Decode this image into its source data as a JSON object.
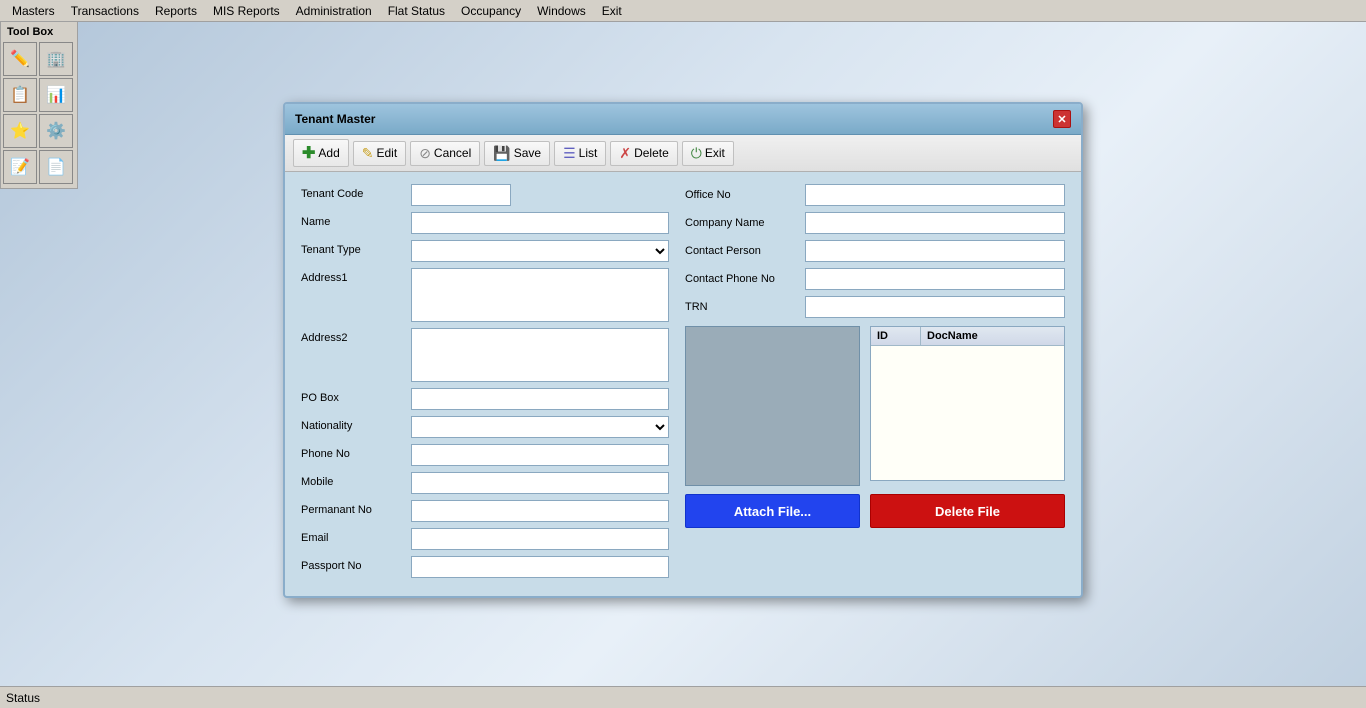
{
  "menubar": {
    "items": [
      {
        "label": "Masters",
        "id": "masters"
      },
      {
        "label": "Transactions",
        "id": "transactions"
      },
      {
        "label": "Reports",
        "id": "reports"
      },
      {
        "label": "MIS Reports",
        "id": "mis-reports"
      },
      {
        "label": "Administration",
        "id": "administration"
      },
      {
        "label": "Flat Status",
        "id": "flat-status"
      },
      {
        "label": "Occupancy",
        "id": "occupancy"
      },
      {
        "label": "Windows",
        "id": "windows"
      },
      {
        "label": "Exit",
        "id": "exit"
      }
    ]
  },
  "toolbox": {
    "title": "Tool Box"
  },
  "statusbar": {
    "label": "Status"
  },
  "modal": {
    "title": "Tenant Master",
    "toolbar": {
      "add": "Add",
      "edit": "Edit",
      "cancel": "Cancel",
      "save": "Save",
      "list": "List",
      "delete": "Delete",
      "exit": "Exit"
    },
    "form_left": {
      "tenant_code_label": "Tenant Code",
      "name_label": "Name",
      "tenant_type_label": "Tenant Type",
      "address1_label": "Address1",
      "address2_label": "Address2",
      "po_box_label": "PO Box",
      "nationality_label": "Nationality",
      "phone_no_label": "Phone No",
      "mobile_label": "Mobile",
      "permanant_no_label": "Permanant No",
      "email_label": "Email",
      "passport_no_label": "Passport No"
    },
    "form_right": {
      "office_no_label": "Office No",
      "company_name_label": "Company Name",
      "contact_person_label": "Contact Person",
      "contact_phone_label": "Contact Phone No",
      "trn_label": "TRN"
    },
    "doc_grid": {
      "col_id": "ID",
      "col_docname": "DocName"
    },
    "buttons": {
      "attach_file": "Attach File...",
      "delete_file": "Delete File"
    }
  }
}
